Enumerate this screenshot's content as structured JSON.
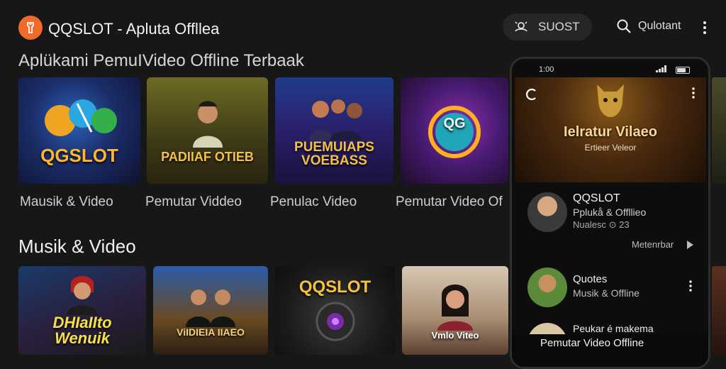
{
  "header": {
    "title": "QQSLOT - Apluta Offlleа",
    "pill_label": "SUOST",
    "search_label": "Qulotant"
  },
  "sections": [
    {
      "title": "Aplükami PemuIVideo Offline Terbaak",
      "cards": [
        {
          "overlay": "QGSLOT",
          "caption": "Mausik & Video"
        },
        {
          "overlay": "PADIIAF OTIEB",
          "caption": "Pemutar Viddeo"
        },
        {
          "overlay": "PUEMUIAPS VOEBASS",
          "caption": "Penulac Video"
        },
        {
          "overlay": "QG",
          "caption": "Pemutar Video Of"
        }
      ]
    },
    {
      "title": "Musik & Video",
      "cards": [
        {
          "overlay": "DHIaIIto Wenuik"
        },
        {
          "overlay": "ViIDIEIA IIAEO"
        },
        {
          "overlay": "QQSLOT"
        },
        {
          "overlay": "Vmlo Viteo"
        }
      ]
    }
  ],
  "phone": {
    "time": "1:00",
    "hero_title": "Ielratur Vilaeo",
    "hero_subtitle": "Ertieer Veleor",
    "channel_name": "QQSLOT",
    "channel_sub": "Pplukå & Offllieo",
    "channel_meta": "Nualesc ⊙ 23",
    "more_label": "Metenrbar",
    "item2_title": "Quotes",
    "item2_sub": "Musik & Offline",
    "item3_title": "Peukar é makema",
    "bottom_text": "Pemutar Video Offline"
  },
  "icons": {
    "logo": "logo-icon",
    "pill": "cast-icon",
    "search": "search-icon",
    "menu": "kebab-menu-icon"
  },
  "colors": {
    "accent": "#f26a2a",
    "background": "#171717"
  }
}
